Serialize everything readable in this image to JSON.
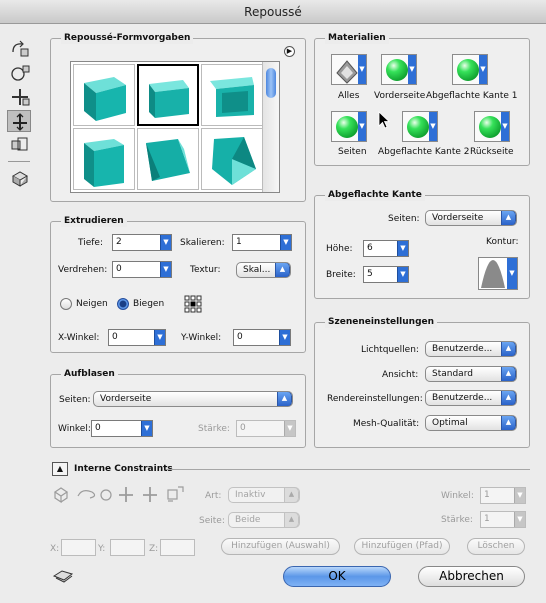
{
  "window": {
    "title": "Repoussé"
  },
  "preset_group": {
    "title": "Repoussé-Formvorgaben"
  },
  "extrude": {
    "title": "Extrudieren",
    "depth_label": "Tiefe:",
    "depth_value": "2",
    "scale_label": "Skalieren:",
    "scale_value": "1",
    "twist_label": "Verdrehen:",
    "twist_value": "0",
    "texture_label": "Textur:",
    "texture_value": "Skal...",
    "tilt_label": "Neigen",
    "bend_label": "Biegen",
    "selected": "Biegen",
    "xangle_label": "X-Winkel:",
    "xangle_value": "0",
    "yangle_label": "Y-Winkel:",
    "yangle_value": "0"
  },
  "inflate": {
    "title": "Aufblasen",
    "sides_label": "Seiten:",
    "sides_value": "Vorderseite",
    "angle_label": "Winkel:",
    "angle_value": "0",
    "strength_label": "Stärke:",
    "strength_value": "0"
  },
  "materials": {
    "title": "Materialien",
    "items": [
      {
        "label": "Alles"
      },
      {
        "label": "Vorderseite"
      },
      {
        "label": "Abgeflachte Kante 1"
      },
      {
        "label": "Seiten"
      },
      {
        "label": "Abgeflachte Kante 2"
      },
      {
        "label": "Rückseite"
      }
    ]
  },
  "bevel": {
    "title": "Abgeflachte Kante",
    "sides_label": "Seiten:",
    "sides_value": "Vorderseite",
    "height_label": "Höhe:",
    "height_value": "6",
    "width_label": "Breite:",
    "width_value": "5",
    "contour_label": "Kontur:"
  },
  "scene": {
    "title": "Szeneneinstellungen",
    "lights_label": "Lichtquellen:",
    "lights_value": "Benutzerde...",
    "view_label": "Ansicht:",
    "view_value": "Standard",
    "render_label": "Rendereinstellungen:",
    "render_value": "Benutzerde...",
    "mesh_label": "Mesh-Qualität:",
    "mesh_value": "Optimal"
  },
  "constraints": {
    "title": "Interne Constraints",
    "mode_label": "Art:",
    "mode_value": "Inaktiv",
    "side_label": "Seite:",
    "side_value": "Beide",
    "angle_label": "Winkel:",
    "angle_value": "1",
    "strength_label": "Stärke:",
    "strength_value": "1",
    "x_label": "X:",
    "y_label": "Y:",
    "z_label": "Z:",
    "add_selection": "Hinzufügen (Auswahl)",
    "add_path": "Hinzufügen (Pfad)",
    "delete": "Löschen"
  },
  "buttons": {
    "ok": "OK",
    "cancel": "Abbrechen"
  },
  "colors": {
    "accent": "#2e6fd6",
    "material_green": "#22c044",
    "cube_teal": "#17a9a3"
  }
}
